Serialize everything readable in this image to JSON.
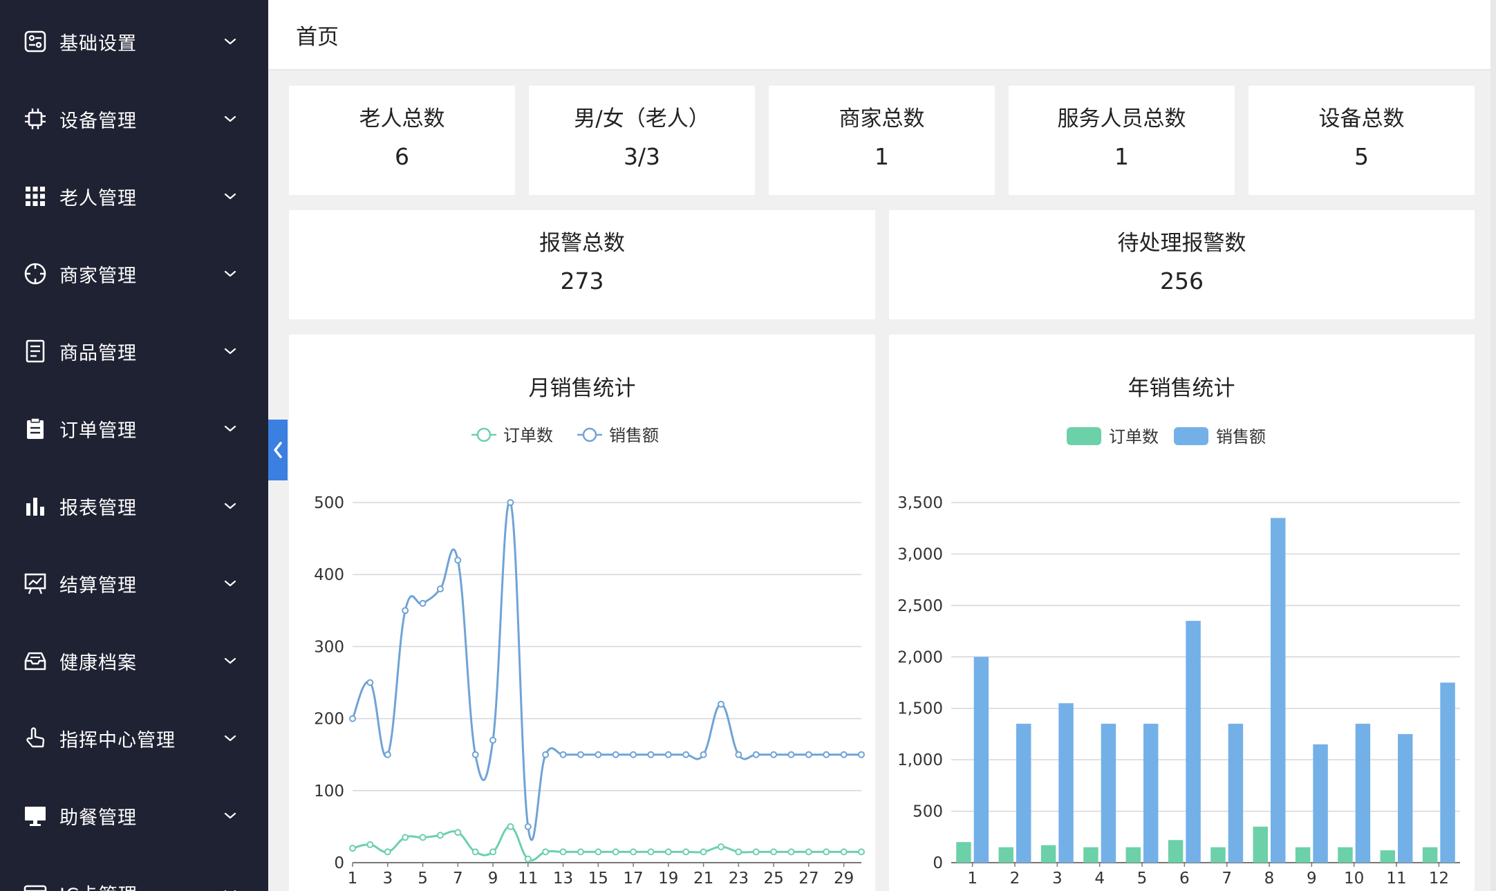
{
  "sidebar": {
    "items": [
      {
        "label": "基础设置",
        "icon": "settings-panel-icon"
      },
      {
        "label": "设备管理",
        "icon": "chip-icon"
      },
      {
        "label": "老人管理",
        "icon": "grid-icon"
      },
      {
        "label": "商家管理",
        "icon": "crosshair-icon"
      },
      {
        "label": "商品管理",
        "icon": "document-icon"
      },
      {
        "label": "订单管理",
        "icon": "clipboard-icon"
      },
      {
        "label": "报表管理",
        "icon": "bar-chart-icon"
      },
      {
        "label": "结算管理",
        "icon": "presentation-chart-icon"
      },
      {
        "label": "健康档案",
        "icon": "inbox-icon"
      },
      {
        "label": "指挥中心管理",
        "icon": "hand-pointer-icon"
      },
      {
        "label": "助餐管理",
        "icon": "monitor-icon"
      },
      {
        "label": "IC卡管理",
        "icon": "card-icon"
      }
    ]
  },
  "header": {
    "title": "首页"
  },
  "stats": {
    "elderly_total": {
      "label": "老人总数",
      "value": "6"
    },
    "gender_ratio": {
      "label": "男/女（老人）",
      "value": "3/3"
    },
    "merchant_total": {
      "label": "商家总数",
      "value": "1"
    },
    "staff_total": {
      "label": "服务人员总数",
      "value": "1"
    },
    "device_total": {
      "label": "设备总数",
      "value": "5"
    },
    "alarm_total": {
      "label": "报警总数",
      "value": "273"
    },
    "alarm_pending": {
      "label": "待处理报警数",
      "value": "256"
    }
  },
  "colors": {
    "sidebar_bg": "#1f2233",
    "accent_blue": "#3b7fe0",
    "series_orders": "#6cd0a9",
    "series_sales_line": "#6fa3d6",
    "series_sales_bar": "#74b0e8"
  },
  "chart_data": [
    {
      "type": "line",
      "title": "月销售统计",
      "x": [
        1,
        2,
        3,
        4,
        5,
        6,
        7,
        8,
        9,
        10,
        11,
        12,
        13,
        14,
        15,
        16,
        17,
        18,
        19,
        20,
        21,
        22,
        23,
        24,
        25,
        26,
        27,
        28,
        29,
        30
      ],
      "x_tick_labels": [
        "1",
        "3",
        "5",
        "7",
        "9",
        "11",
        "13",
        "15",
        "17",
        "19",
        "21",
        "23",
        "25",
        "27",
        "29"
      ],
      "series": [
        {
          "name": "订单数",
          "values": [
            20,
            25,
            15,
            35,
            35,
            38,
            42,
            15,
            15,
            50,
            5,
            15,
            15,
            15,
            15,
            15,
            15,
            15,
            15,
            15,
            15,
            22,
            15,
            15,
            15,
            15,
            15,
            15,
            15,
            15
          ]
        },
        {
          "name": "销售额",
          "values": [
            200,
            250,
            150,
            350,
            360,
            380,
            420,
            150,
            170,
            500,
            50,
            150,
            150,
            150,
            150,
            150,
            150,
            150,
            150,
            150,
            150,
            220,
            150,
            150,
            150,
            150,
            150,
            150,
            150,
            150
          ]
        }
      ],
      "ylim": [
        0,
        500
      ],
      "y_ticks": [
        0,
        100,
        200,
        300,
        400,
        500
      ],
      "legend": "top-center",
      "grid": true
    },
    {
      "type": "bar",
      "title": "年销售统计",
      "categories": [
        "1",
        "2",
        "3",
        "4",
        "5",
        "6",
        "7",
        "8",
        "9",
        "10",
        "11",
        "12"
      ],
      "series": [
        {
          "name": "订单数",
          "values": [
            200,
            150,
            170,
            150,
            150,
            220,
            150,
            350,
            150,
            150,
            120,
            150
          ]
        },
        {
          "name": "销售额",
          "values": [
            2000,
            1350,
            1550,
            1350,
            1350,
            2350,
            1350,
            3350,
            1150,
            1350,
            1250,
            1750
          ]
        }
      ],
      "ylim": [
        0,
        3500
      ],
      "y_ticks": [
        0,
        500,
        1000,
        1500,
        2000,
        2500,
        3000,
        3500
      ],
      "y_tick_labels": [
        "0",
        "500",
        "1,000",
        "1,500",
        "2,000",
        "2,500",
        "3,000",
        "3,500"
      ],
      "legend": "top-center",
      "grid": true
    }
  ]
}
